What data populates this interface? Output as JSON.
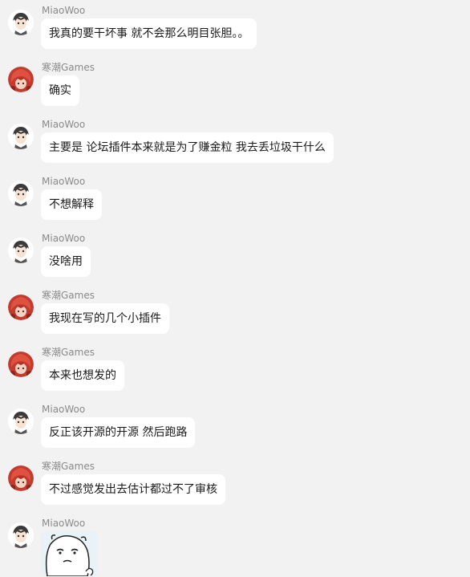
{
  "users": {
    "miaowoo": {
      "name": "MiaoWoo",
      "avatar_icon": "anime-boy-avatar-icon"
    },
    "hanchao": {
      "name": "寒潮Games",
      "avatar_icon": "red-hair-avatar-icon"
    }
  },
  "messages": [
    {
      "sender": "MiaoWoo",
      "text": "我真的要干坏事 就不会那么明目张胆。。"
    },
    {
      "sender": "寒潮Games",
      "text": "确实"
    },
    {
      "sender": "MiaoWoo",
      "text": "主要是 论坛插件本来就是为了赚金粒 我去丢垃圾干什么"
    },
    {
      "sender": "MiaoWoo",
      "text": "不想解释"
    },
    {
      "sender": "MiaoWoo",
      "text": "没啥用"
    },
    {
      "sender": "寒潮Games",
      "text": "我现在写的几个小插件"
    },
    {
      "sender": "寒潮Games",
      "text": "本来也想发的"
    },
    {
      "sender": "MiaoWoo",
      "text": "反正该开源的开源 然后跑路"
    },
    {
      "sender": "寒潮Games",
      "text": "不过感觉发出去估计都过不了审核"
    },
    {
      "sender": "MiaoWoo",
      "sticker": "meme-face-sticker"
    }
  ],
  "colors": {
    "background": "#f2f2f2",
    "bubble": "#ffffff",
    "sender_name": "#8a8a8a",
    "text": "#1a1a1a"
  }
}
